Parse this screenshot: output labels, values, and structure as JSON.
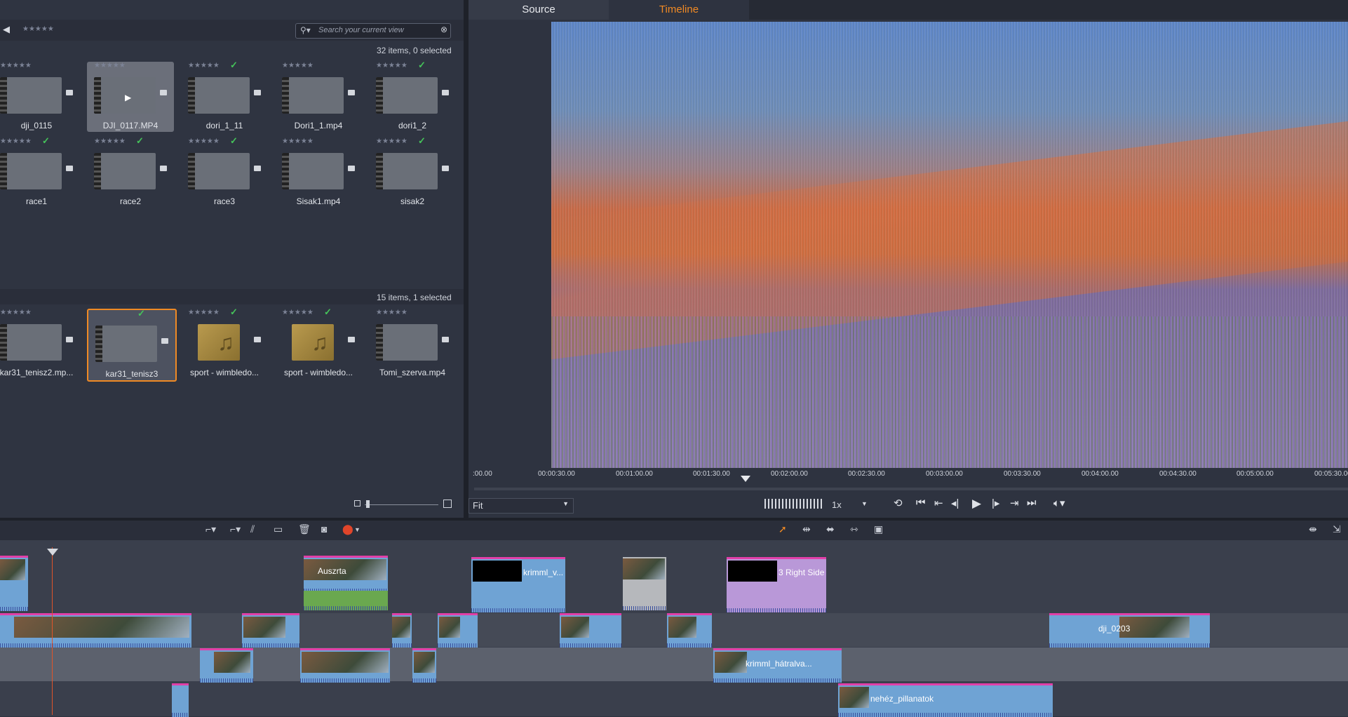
{
  "library": {
    "rating_filter": "★★★★★",
    "search_placeholder": "Search your current view",
    "top_count": "32 items, 0 selected",
    "bottom_count": "15 items, 1 selected",
    "top_items": [
      {
        "label": "dji_0115",
        "stars": "★★★★★",
        "checked": false
      },
      {
        "label": "DJI_0117.MP4",
        "stars": "★★★★★",
        "checked": false
      },
      {
        "label": "dori_1_11",
        "stars": "★★★★★",
        "checked": true
      },
      {
        "label": "Dori1_1.mp4",
        "stars": "★★★★★",
        "checked": false
      },
      {
        "label": "dori1_2",
        "stars": "★★★★★",
        "checked": true
      },
      {
        "label": "race1",
        "stars": "★★★★★",
        "checked": true
      },
      {
        "label": "race2",
        "stars": "★★★★★",
        "checked": true
      },
      {
        "label": "race3",
        "stars": "★★★★★",
        "checked": true
      },
      {
        "label": "Sisak1.mp4",
        "stars": "★★★★★",
        "checked": false
      },
      {
        "label": "sisak2",
        "stars": "★★★★★",
        "checked": true
      }
    ],
    "bottom_items": [
      {
        "label": "kar31_tenisz2.mp...",
        "stars": "★★★★★",
        "checked": false
      },
      {
        "label": "kar31_tenisz3",
        "stars": "",
        "checked": true
      },
      {
        "label": "sport - wimbledo...",
        "stars": "★★★★★",
        "checked": true
      },
      {
        "label": "sport - wimbledo...",
        "stars": "★★★★★",
        "checked": true
      },
      {
        "label": "Tomi_szerva.mp4",
        "stars": "★★★★★",
        "checked": false
      }
    ]
  },
  "preview": {
    "tabs": [
      "Source",
      "Timeline"
    ],
    "active_tab": "Timeline",
    "ruler_ticks": [
      ":00.00",
      "00:00:30.00",
      "00:01:00.00",
      "00:01:30.00",
      "00:02:00.00",
      "00:02:30.00",
      "00:03:00.00",
      "00:03:30.00",
      "00:04:00.00",
      "00:04:30.00",
      "00:05:00.00",
      "00:05:30.00"
    ],
    "fit_label": "Fit",
    "speed_label": "1x"
  },
  "timeline": {
    "clips": [
      {
        "label": "Auszrta",
        "track": 0
      },
      {
        "label": "krimml_v...",
        "track": 0
      },
      {
        "label": "3 Right Side",
        "track": 0
      },
      {
        "label": "dji_0203",
        "track": 1
      },
      {
        "label": "krimml_hátralva...",
        "track": 2
      },
      {
        "label": "nehéz_pillanatok",
        "track": 3
      }
    ]
  },
  "colors": {
    "accent": "#f08a24",
    "clip_blue": "#6fa3d4",
    "clip_magenta": "#e23fa8",
    "check": "#45c45a"
  }
}
